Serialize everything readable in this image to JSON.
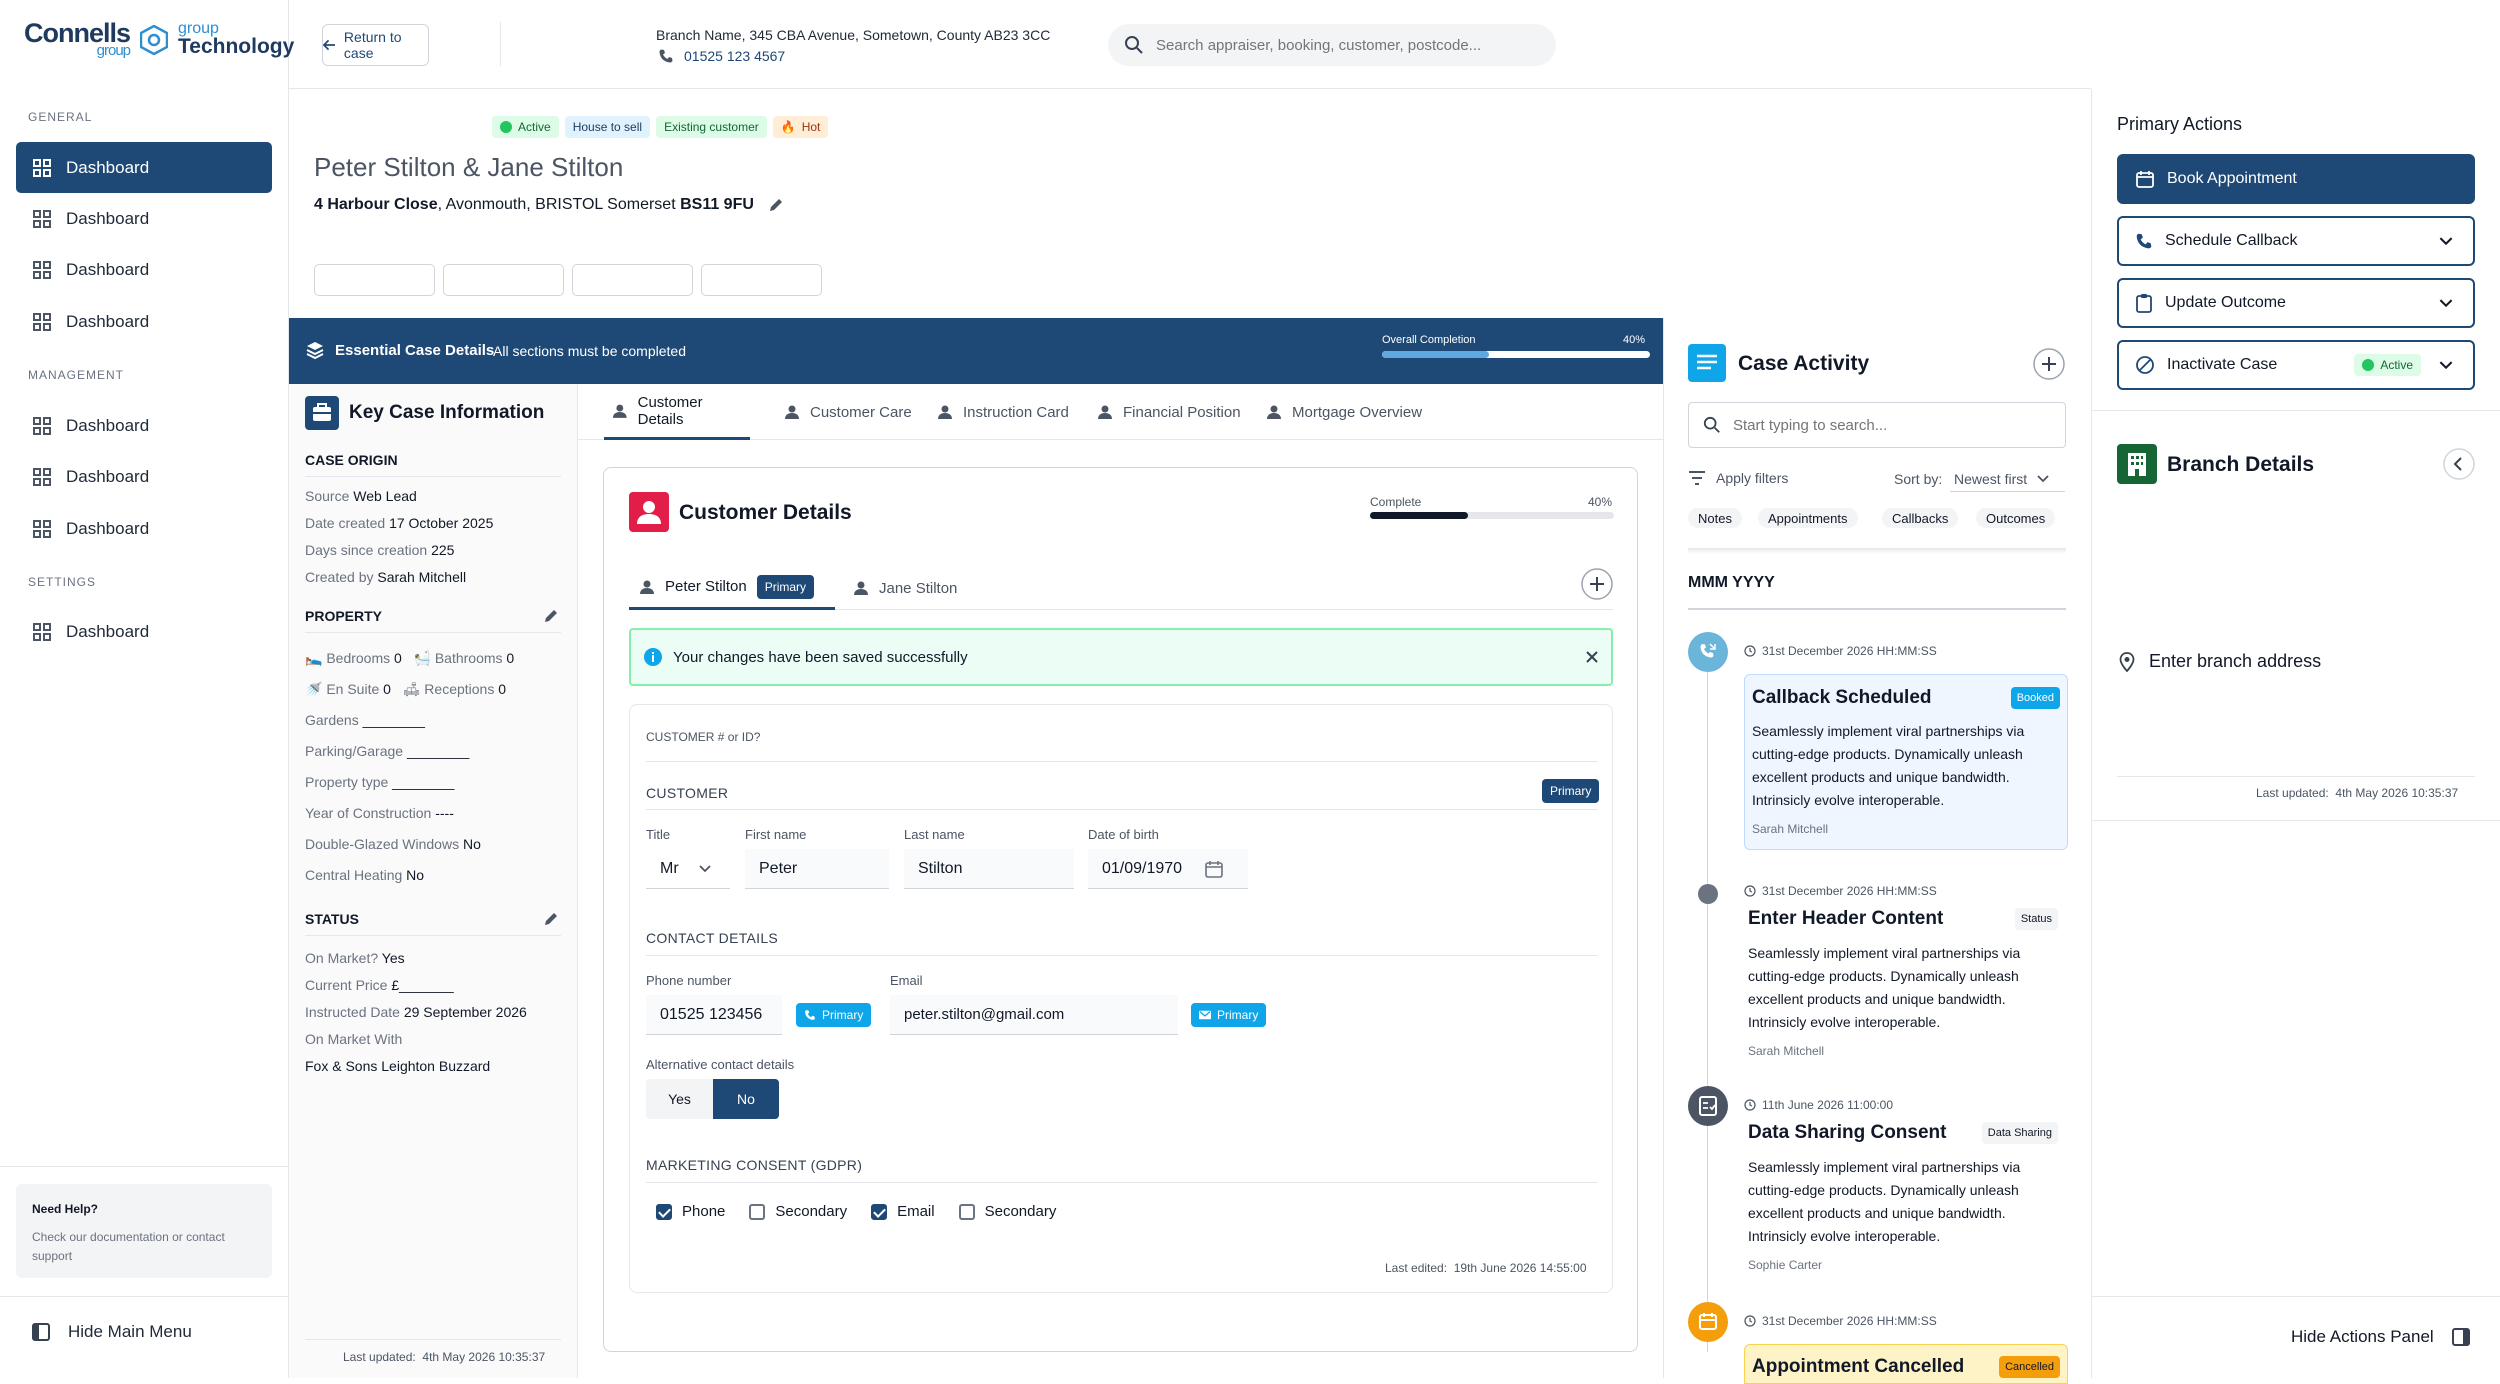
{
  "brand": {
    "part1": "Connells",
    "part1_sub": "group",
    "part2_sub": "group",
    "part2": "Technology"
  },
  "nav": {
    "general_label": "GENERAL",
    "management_label": "MANAGEMENT",
    "settings_label": "SETTINGS",
    "general": [
      "Dashboard",
      "Dashboard",
      "Dashboard",
      "Dashboard"
    ],
    "management": [
      "Dashboard",
      "Dashboard",
      "Dashboard"
    ],
    "settings": [
      "Dashboard"
    ],
    "help_title": "Need Help?",
    "help_text": "Check our documentation or contact support",
    "hide_menu": "Hide Main Menu"
  },
  "topbar": {
    "return_label": "Return to case",
    "branch_line": "Branch Name, 345 CBA Avenue, Sometown, County AB23 3CC",
    "branch_phone": "01525 123 4567",
    "search_placeholder": "Search appraiser, booking, customer, postcode..."
  },
  "case": {
    "tags": [
      "Active",
      "House to sell",
      "Existing customer",
      "Hot"
    ],
    "title": "Peter Stilton & Jane Stilton",
    "addr_street": "4 Harbour Close",
    "addr_rest": ", Avonmouth, BRISTOL Somerset",
    "addr_postcode": "BS11 9FU"
  },
  "banner": {
    "title": "Essential Case Details",
    "subtitle": "All sections must be completed",
    "completion_label": "Overall Completion",
    "completion_value": "40%",
    "completion_fraction": 0.4
  },
  "key_info": {
    "title": "Key Case Information",
    "origin_heading": "CASE ORIGIN",
    "source_label": "Source",
    "source": "Web Lead",
    "date_created_label": "Date created",
    "date_created": "17 October 2025",
    "days_label": "Days since creation",
    "days": "225",
    "created_by_label": "Created by",
    "created_by": "Sarah Mitchell",
    "property_heading": "PROPERTY",
    "bedrooms_label": "Bedrooms",
    "bedrooms": "0",
    "bathrooms_label": "Bathrooms",
    "bathrooms": "0",
    "ensuite_label": "En Suite",
    "ensuite": "0",
    "receptions_label": "Receptions",
    "receptions": "0",
    "gardens_label": "Gardens",
    "gardens": "________",
    "parking_label": "Parking/Garage",
    "parking": "________",
    "ptype_label": "Property type",
    "ptype": "________",
    "year_label": "Year of Construction",
    "year": "----",
    "glazing_label": "Double-Glazed Windows",
    "glazing": "No",
    "heating_label": "Central Heating",
    "heating": "No",
    "status_heading": "STATUS",
    "on_market_label": "On Market?",
    "on_market": "Yes",
    "price_label": "Current Price",
    "price": "£_______",
    "instructed_label": "Instructed Date",
    "instructed": "29 September 2026",
    "market_with_label": "On Market With",
    "market_with": "Fox & Sons Leighton Buzzard",
    "last_updated_label": "Last updated:",
    "last_updated": "4th May 2026 10:35:37"
  },
  "tabs": [
    "Customer Details",
    "Customer Care",
    "Instruction Card",
    "Financial Position",
    "Mortgage Overview"
  ],
  "customer_card": {
    "title": "Customer Details",
    "complete_label": "Complete",
    "complete_value": "40%",
    "complete_fraction": 0.4,
    "person1": "Peter Stilton",
    "person1_badge": "Primary",
    "person2": "Jane Stilton",
    "success_msg": "Your changes have been saved successfully",
    "customer_id_label": "CUSTOMER # or ID?",
    "customer_heading": "CUSTOMER",
    "customer_badge": "Primary",
    "title_label": "Title",
    "title_value": "Mr",
    "first_label": "First name",
    "first_value": "Peter",
    "last_label": "Last name",
    "last_value": "Stilton",
    "dob_label": "Date of birth",
    "dob_value": "01/09/1970",
    "contact_heading": "CONTACT DETAILS",
    "phone_label": "Phone number",
    "phone_value": "01525 123456",
    "phone_badge": "Primary",
    "email_label": "Email",
    "email_value": "peter.stilton@gmail.com",
    "email_badge": "Primary",
    "alt_label": "Alternative contact details",
    "alt_yes": "Yes",
    "alt_no": "No",
    "gdpr_heading": "MARKETING CONSENT (GDPR)",
    "consent": [
      {
        "label": "Phone",
        "checked": true
      },
      {
        "label": "Secondary",
        "checked": false
      },
      {
        "label": "Email",
        "checked": true
      },
      {
        "label": "Secondary",
        "checked": false
      }
    ],
    "last_edited_label": "Last edited:",
    "last_edited": "19th June 2026 14:55:00"
  },
  "activity": {
    "title": "Case Activity",
    "search_placeholder": "Start typing to search...",
    "filters_label": "Apply filters",
    "sort_label": "Sort by:",
    "sort_value": "Newest first",
    "chips": [
      "Notes",
      "Appointments",
      "Callbacks",
      "Outcomes"
    ],
    "month": "MMM YYYY",
    "events": [
      {
        "date": "31st December 2026  HH:MM:SS",
        "title": "Callback Scheduled",
        "badge": "Booked",
        "text": "Seamlessly implement viral partnerships via cutting-edge products. Dynamically unleash excellent products and unique bandwidth. Intrinsicly evolve interoperable.",
        "by": "Sarah Mitchell"
      },
      {
        "date": "31st December 2026  HH:MM:SS",
        "title": "Enter Header Content",
        "badge": "Status",
        "text": "Seamlessly implement viral partnerships via cutting-edge products. Dynamically unleash excellent products and unique bandwidth. Intrinsicly evolve interoperable.",
        "by": "Sarah Mitchell"
      },
      {
        "date": "11th June 2026  11:00:00",
        "title": "Data Sharing Consent",
        "badge": "Data Sharing",
        "text": "Seamlessly implement viral partnerships via cutting-edge products. Dynamically unleash excellent products and unique bandwidth. Intrinsicly evolve interoperable.",
        "by": "Sophie Carter"
      },
      {
        "date": "31st December 2026  HH:MM:SS",
        "title": "Appointment Cancelled",
        "badge": "Cancelled"
      }
    ]
  },
  "primary_actions": {
    "title": "Primary Actions",
    "book": "Book Appointment",
    "callback": "Schedule Callback",
    "outcome": "Update Outcome",
    "inactivate": "Inactivate Case",
    "inactivate_badge": "Active"
  },
  "branch_details": {
    "title": "Branch Details",
    "address_placeholder": "Enter branch address",
    "last_updated_label": "Last updated:",
    "last_updated": "4th May 2026 10:35:37"
  },
  "hide_actions": "Hide Actions Panel",
  "colors": {
    "brand": "#1e4976",
    "accent_pink": "#e11d48",
    "accent_blue": "#0ea5e9",
    "success": "#22c55e",
    "warning": "#f59e0b"
  }
}
